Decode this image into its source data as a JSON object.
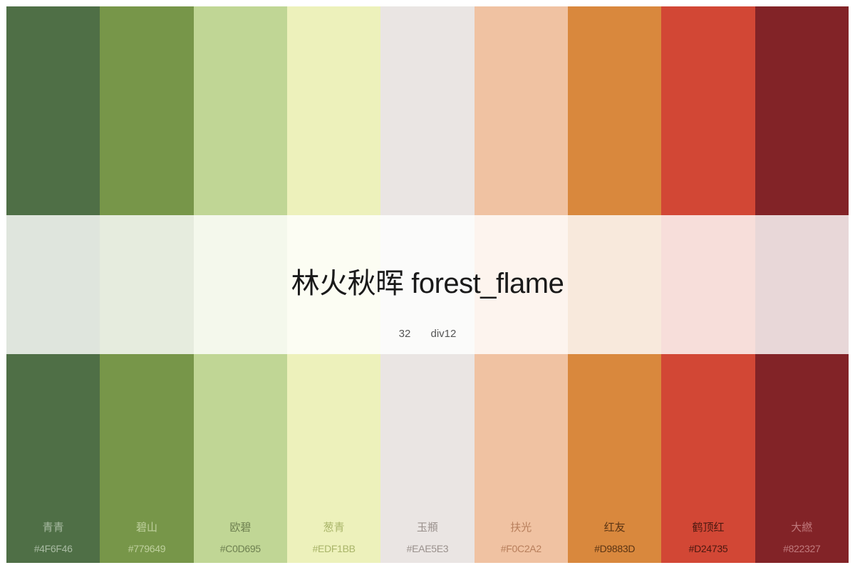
{
  "palette": {
    "title": "林火秋晖 forest_flame",
    "count": "32",
    "type": "div12",
    "swatches": [
      {
        "name": "青青",
        "hex": "#4F6F46",
        "color": "#4F6F46",
        "text_color": "#A9BBA3"
      },
      {
        "name": "碧山",
        "hex": "#779649",
        "color": "#779649",
        "text_color": "#BFD09E"
      },
      {
        "name": "欧碧",
        "hex": "#C0D695",
        "color": "#C0D695",
        "text_color": "#6E8051"
      },
      {
        "name": "葱青",
        "hex": "#EDF1BB",
        "color": "#EDF1BB",
        "text_color": "#A9B569"
      },
      {
        "name": "玉頩",
        "hex": "#EAE5E3",
        "color": "#EAE5E3",
        "text_color": "#9A918D"
      },
      {
        "name": "扶光",
        "hex": "#F0C2A2",
        "color": "#F0C2A2",
        "text_color": "#B87F5C"
      },
      {
        "name": "红友",
        "hex": "#D9883D",
        "color": "#D9883D",
        "text_color": "#5A3414"
      },
      {
        "name": "鹤顶红",
        "hex": "#D24735",
        "color": "#D24735",
        "text_color": "#4A1810"
      },
      {
        "name": "大繎",
        "hex": "#822327",
        "color": "#822327",
        "text_color": "#C07A7D"
      }
    ]
  }
}
